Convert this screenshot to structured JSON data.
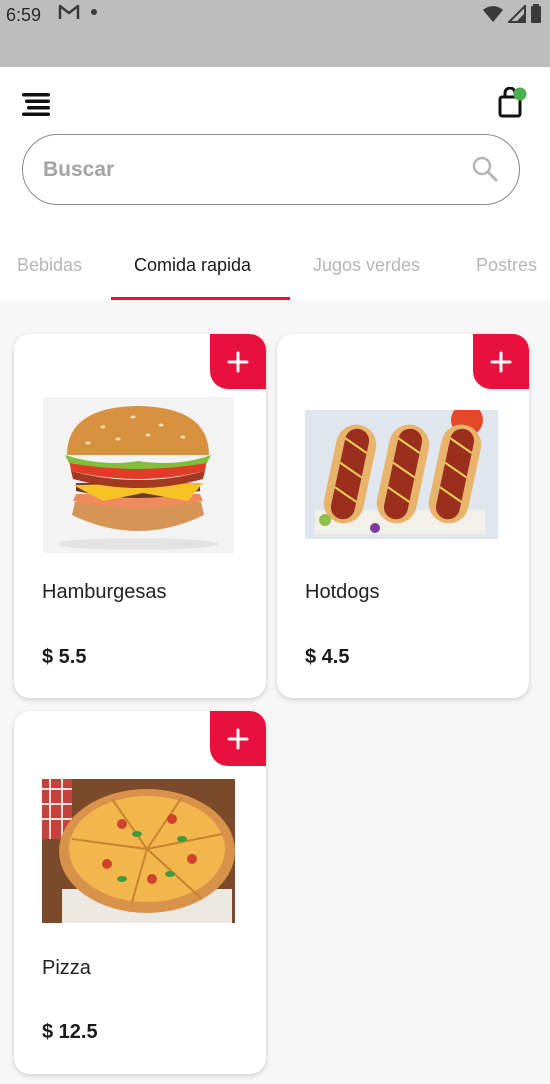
{
  "status_bar": {
    "time": "6:59",
    "icons": [
      "gmail-icon",
      "dot-icon",
      "wifi-icon",
      "signal-icon",
      "battery-icon"
    ]
  },
  "header": {
    "menu_icon": "menu-icon",
    "cart_icon": "shopping-bag-icon",
    "cart_badge_color": "#4caf50"
  },
  "search": {
    "placeholder": "Buscar",
    "value": ""
  },
  "tabs": [
    {
      "label": "Bebidas",
      "active": false
    },
    {
      "label": "Comida rapida",
      "active": true
    },
    {
      "label": "Jugos verdes",
      "active": false
    },
    {
      "label": "Postres",
      "active": false
    }
  ],
  "products": [
    {
      "name": "Hamburgesas",
      "price": "$ 5.5"
    },
    {
      "name": "Hotdogs",
      "price": "$ 4.5"
    },
    {
      "name": "Pizza",
      "price": "$ 12.5"
    }
  ],
  "colors": {
    "accent": "#e8103c",
    "background": "#f7f7f7",
    "status_bar": "#bdbdbd"
  }
}
